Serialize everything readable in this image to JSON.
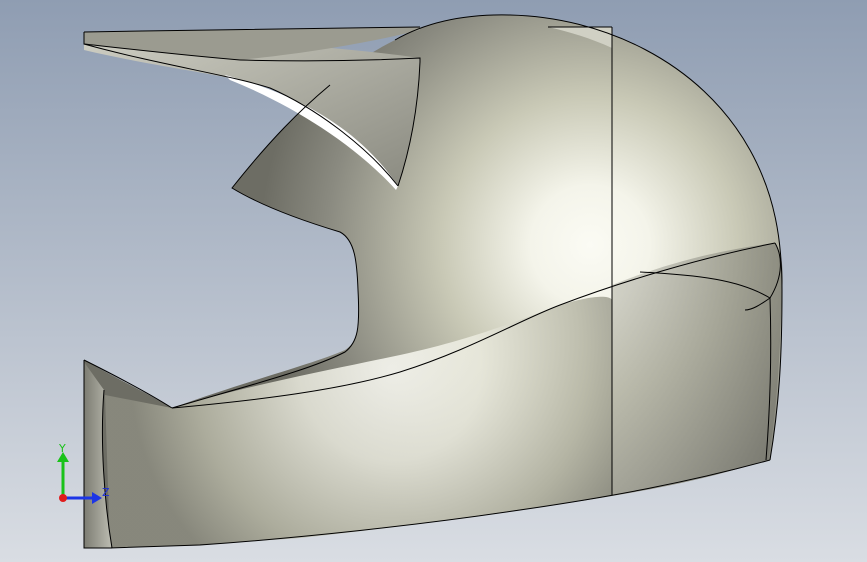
{
  "viewport": {
    "background_top": "#8f9db2",
    "background_bottom": "#d9dde3"
  },
  "model": {
    "shading_highlight": "#fbfbf4",
    "shading_mid": "#c9c9b6",
    "shading_dark": "#6d6d64",
    "edge_color": "#000000"
  },
  "triad": {
    "y_label": "Y",
    "z_label": "Z",
    "y_color": "#19c219",
    "z_color": "#1c35e6",
    "x_color": "#e01c1c",
    "label_color": "#1c2fd6"
  }
}
